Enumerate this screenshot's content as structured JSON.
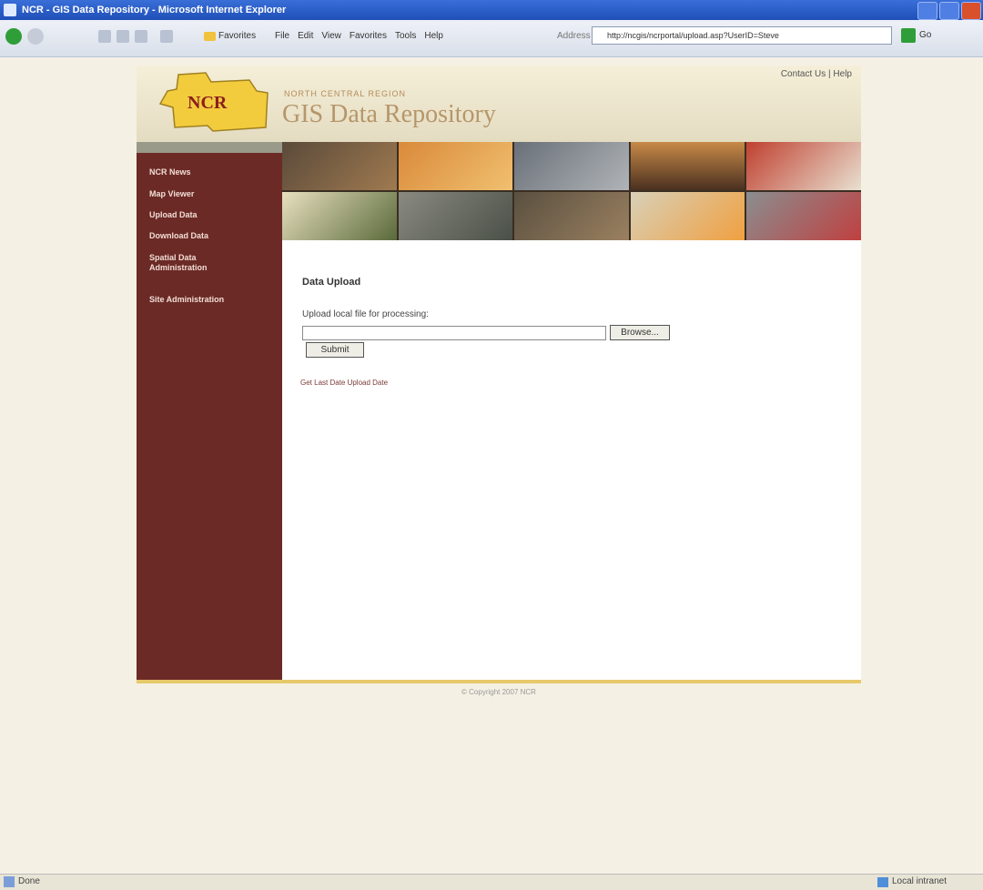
{
  "window": {
    "title": "NCR - GIS Data Repository - Microsoft Internet Explorer"
  },
  "toolbar": {
    "favorites_label": "Favorites",
    "menu": [
      "File",
      "Edit",
      "View",
      "Favorites",
      "Tools",
      "Help"
    ],
    "address_label": "Address",
    "address_value": "http://ncgis/ncrportal/upload.asp?UserID=Steve",
    "go_label": "Go"
  },
  "header": {
    "logo_text": "NCR",
    "subtitle": "NORTH CENTRAL REGION",
    "title": "GIS Data Repository",
    "contact": "Contact Us | Help"
  },
  "sidebar": {
    "items": [
      {
        "label": "NCR News"
      },
      {
        "label": "Map Viewer"
      },
      {
        "label": "Upload Data"
      },
      {
        "label": "Download Data"
      },
      {
        "label": "Spatial Data Administration"
      },
      {
        "label": "Site Administration"
      }
    ]
  },
  "main": {
    "heading": "Data Upload",
    "upload_label": "Upload local file for processing:",
    "file_value": "",
    "browse_label": "Browse...",
    "submit_label": "Submit",
    "last_date_link": "Get Last Date Upload Date"
  },
  "footer": {
    "copyright": "© Copyright 2007 NCR"
  },
  "status": {
    "text": "Done",
    "zone": "Local intranet"
  },
  "colors": {
    "sidebar": "#6b2a26",
    "accent_bar": "#e6c96a",
    "title": "#b6966a",
    "logo_fill": "#f2cc3d",
    "logo_text": "#8b1e1e"
  },
  "banner_images": [
    {
      "icon": "firefighters-photo"
    },
    {
      "icon": "explosion-photo"
    },
    {
      "icon": "debris-photo"
    },
    {
      "icon": "helicopter-photo"
    },
    {
      "icon": "firetruck-photo"
    },
    {
      "icon": "ambulance-photo"
    },
    {
      "icon": "rubble-photo"
    },
    {
      "icon": "rail-photo"
    },
    {
      "icon": "fire-photo"
    },
    {
      "icon": "collapsed-bridge-photo"
    }
  ]
}
